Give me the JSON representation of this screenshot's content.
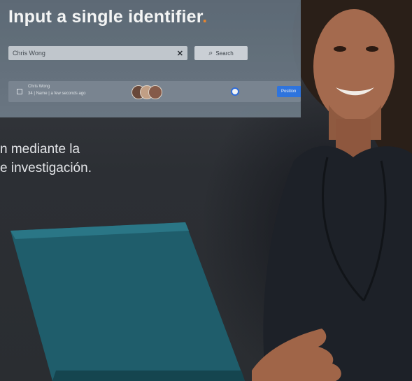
{
  "card": {
    "title": "Input a single identifier",
    "title_dot": ".",
    "search_value": "Chris Wong",
    "clear_icon": "✕",
    "search_button_label": "Search",
    "result": {
      "name": "Chris Wong",
      "meta": "34 | Name | a few seconds ago",
      "action_label": "Position"
    },
    "accent_color": "#f28a2e",
    "button_color": "#2f78e6"
  },
  "body": {
    "line1": "n mediante la",
    "line2": "e investigación."
  }
}
